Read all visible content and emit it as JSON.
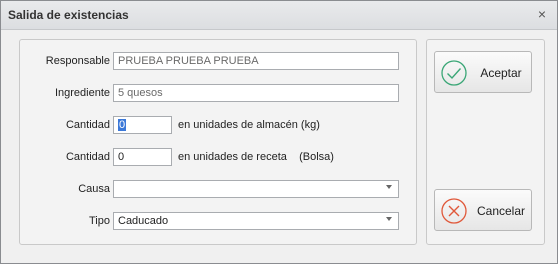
{
  "window": {
    "title": "Salida de existencias",
    "close_glyph": "×"
  },
  "form": {
    "responsable": {
      "label": "Responsable",
      "value": "PRUEBA PRUEBA PRUEBA"
    },
    "ingrediente": {
      "label": "Ingrediente",
      "value": "5 quesos"
    },
    "cantidad_almacen": {
      "label": "Cantidad",
      "value": "0",
      "unit": "en unidades de almacén  (kg)"
    },
    "cantidad_receta": {
      "label": "Cantidad",
      "value": "0",
      "unit": "en unidades de receta    (Bolsa)"
    },
    "causa": {
      "label": "Causa",
      "value": ""
    },
    "tipo": {
      "label": "Tipo",
      "value": "Caducado"
    }
  },
  "buttons": {
    "accept": {
      "label": "Aceptar",
      "icon": "check-circle-icon",
      "color": "#3aa676"
    },
    "cancel": {
      "label": "Cancelar",
      "icon": "x-circle-icon",
      "color": "#e0583a"
    }
  }
}
